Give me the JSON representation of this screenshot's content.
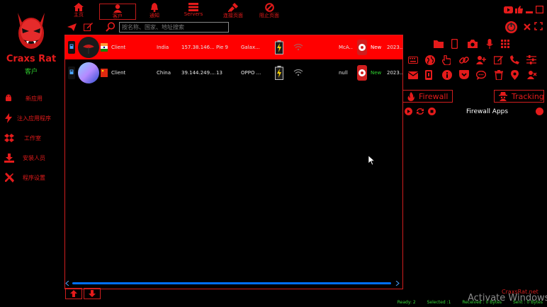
{
  "app": {
    "name": "Craxs Rat",
    "subtitle": "客户",
    "url": "CraxsRat.net"
  },
  "topnav": [
    {
      "label": "主页",
      "icon": "home-icon"
    },
    {
      "label": "客户",
      "icon": "users-icon",
      "active": true
    },
    {
      "label": "通知",
      "icon": "bell-icon"
    },
    {
      "label": "Servers",
      "icon": "servers-icon"
    },
    {
      "label": "连接页面",
      "icon": "plug-icon"
    },
    {
      "label": "阻止页面",
      "icon": "block-icon"
    }
  ],
  "search": {
    "placeholder": "按名称、国家、地址搜索"
  },
  "sidebar": {
    "items": [
      {
        "label": "新应用",
        "icon": "android-icon"
      },
      {
        "label": "注入应用程序",
        "icon": "bolt-icon"
      },
      {
        "label": "工作室",
        "icon": "dropbox-icon"
      },
      {
        "label": "安装人员",
        "icon": "download-icon"
      },
      {
        "label": "程序设置",
        "icon": "tools-icon"
      }
    ]
  },
  "clients": [
    {
      "name": "Client",
      "country": "India",
      "ip": "157.38.146...",
      "os": "Pie 9",
      "device": "Galax...",
      "user": "McA...",
      "status": "New",
      "date": "2023...",
      "flag_colors": [
        "#ff9933",
        "#ffffff",
        "#138808"
      ]
    },
    {
      "name": "Client",
      "country": "China",
      "ip": "39.144.249....",
      "os": "13",
      "device": "OPPO ...",
      "user": "null",
      "status": "New",
      "date": "2023...",
      "flag_colors": [
        "#de2910",
        "#de2910",
        "#ffde00"
      ]
    }
  ],
  "right_panel": {
    "firewall_label": "Firewall",
    "tracking_label": "Tracking",
    "firewall_apps_label": "Firewall Apps"
  },
  "status": {
    "ready": "Ready: 2",
    "selected": "Selected :1",
    "received": "Received : 0 Bytes",
    "sent": "Sent : 0 Bytes"
  },
  "watermark": "Activate Windows",
  "colors": {
    "accent": "#e41b1b",
    "selected_row": "#ff0000",
    "status_green": "#3ad93a",
    "scroll_blue": "#0070ff"
  }
}
